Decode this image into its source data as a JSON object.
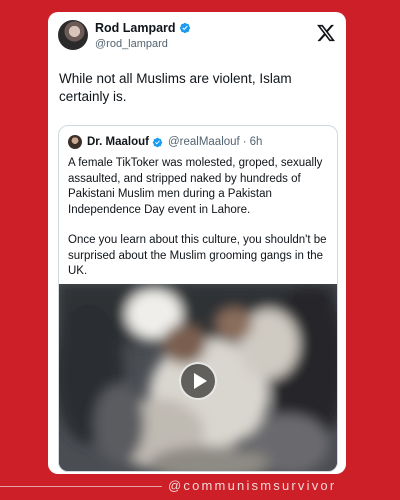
{
  "post": {
    "author_name": "Rod Lampard",
    "author_handle": "@rod_lampard",
    "text": "While not all Muslims are violent, Islam certainly is.",
    "platform_icon": "x-logo-icon"
  },
  "quoted": {
    "author_name": "Dr. Maalouf",
    "author_handle": "@realMaalouf",
    "time": "6h",
    "separator": "·",
    "paragraphs": [
      "A female TikToker was molested, groped, sexually assaulted, and stripped naked by hundreds of Pakistani Muslim men during a Pakistan Independence Day event in Lahore.",
      "Once you learn about this culture, you shouldn't be surprised about the Muslim grooming gangs in the UK."
    ],
    "media": {
      "type": "video",
      "icon": "play-icon"
    }
  },
  "footer": {
    "watermark": "@communismsurvivor"
  },
  "colors": {
    "background": "#cc1f27",
    "card": "#ffffff",
    "verified": "#1d9bf0",
    "text": "#0f1419",
    "muted": "#536471"
  }
}
